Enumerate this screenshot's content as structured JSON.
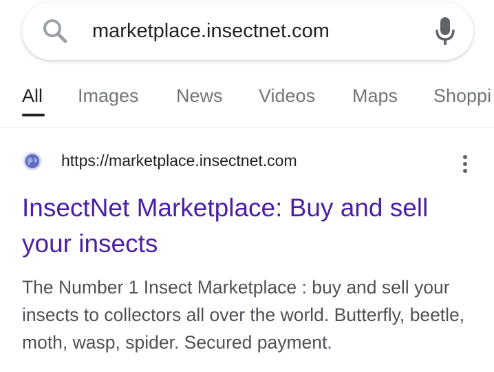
{
  "search": {
    "query": "marketplace.insectnet.com"
  },
  "tabs": [
    {
      "label": "All",
      "active": true
    },
    {
      "label": "Images",
      "active": false
    },
    {
      "label": "News",
      "active": false
    },
    {
      "label": "Videos",
      "active": false
    },
    {
      "label": "Maps",
      "active": false
    },
    {
      "label": "Shoppi",
      "active": false
    }
  ],
  "result": {
    "url": "https://marketplace.insectnet.com",
    "title": "InsectNet Marketplace: Buy and sell your insects",
    "snippet": "The Number 1 Insect Marketplace : buy and sell your insects to collectors all over the world. Butterfly, beetle, moth, wasp, spider. Secured payment."
  },
  "icons": {
    "search": "search-icon",
    "mic": "mic-icon",
    "favicon": "globe-icon",
    "more": "more-vert-icon"
  },
  "colors": {
    "title_link": "#4b1fa5",
    "snippet_text": "#4d5156",
    "tab_inactive": "#70757a",
    "tab_active": "#202124",
    "mic_gray": "#5f6368"
  }
}
